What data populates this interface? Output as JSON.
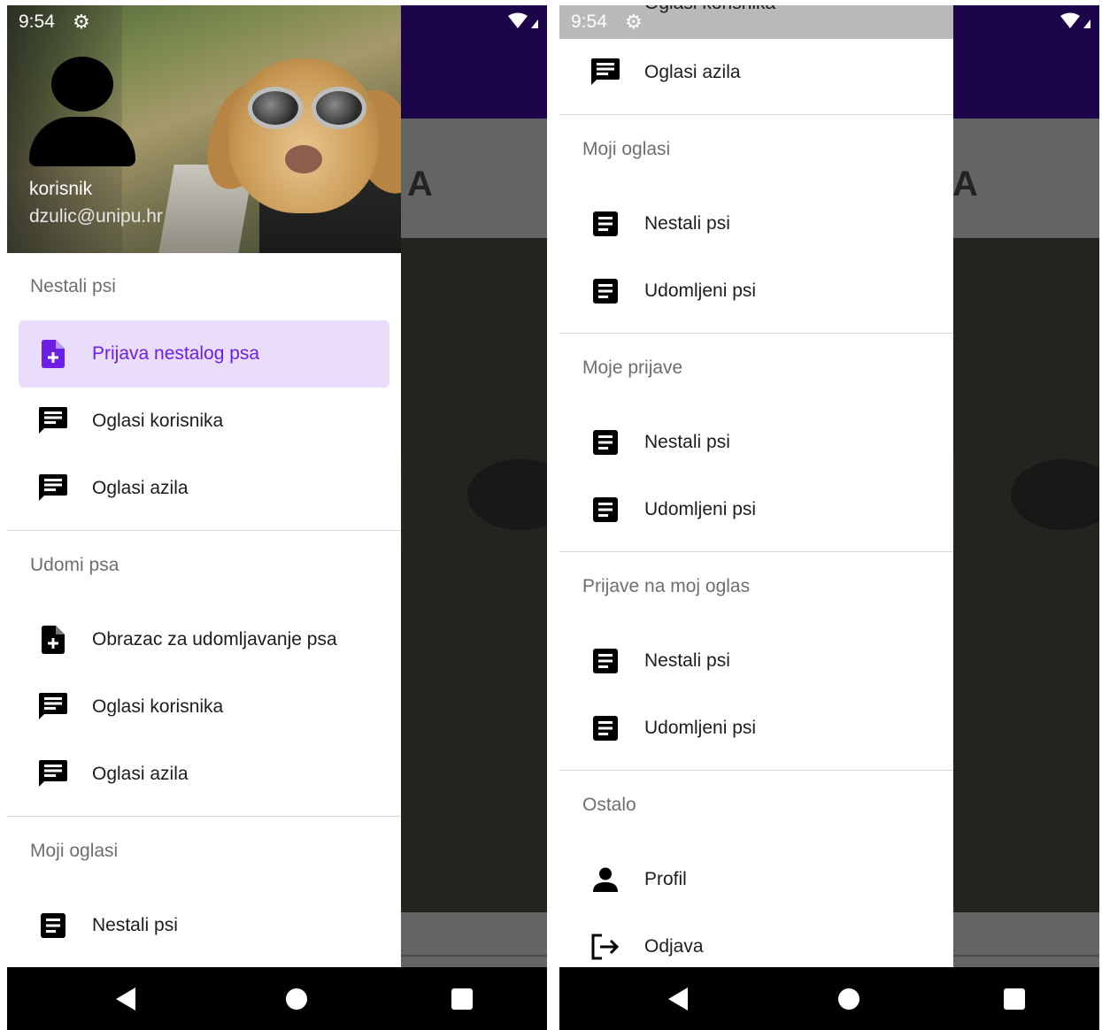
{
  "status_bar": {
    "time": "9:54"
  },
  "background_app": {
    "banner_text_fragment": "A"
  },
  "left_screen": {
    "header": {
      "name": "korisnik",
      "email": "dzulic@unipu.hr"
    },
    "sections": [
      {
        "title": "Nestali psi",
        "items": [
          {
            "label": "Prijava nestalog psa",
            "icon": "add-document-icon",
            "active": true
          },
          {
            "label": "Oglasi korisnika",
            "icon": "chat-message-icon"
          },
          {
            "label": "Oglasi azila",
            "icon": "chat-message-icon"
          }
        ]
      },
      {
        "title": "Udomi psa",
        "items": [
          {
            "label": "Obrazac za udomljavanje psa",
            "icon": "add-document-icon"
          },
          {
            "label": "Oglasi korisnika",
            "icon": "chat-message-icon"
          },
          {
            "label": "Oglasi azila",
            "icon": "chat-message-icon"
          }
        ]
      },
      {
        "title": "Moji oglasi",
        "items": [
          {
            "label": "Nestali psi",
            "icon": "article-icon"
          }
        ]
      }
    ]
  },
  "right_screen": {
    "top_partial_item": {
      "label": "Oglasi korisnika",
      "icon": "chat-message-icon"
    },
    "sections": [
      {
        "title": "",
        "items": [
          {
            "label": "Oglasi azila",
            "icon": "chat-message-icon"
          }
        ]
      },
      {
        "title": "Moji oglasi",
        "items": [
          {
            "label": "Nestali psi",
            "icon": "article-icon"
          },
          {
            "label": "Udomljeni psi",
            "icon": "article-icon"
          }
        ]
      },
      {
        "title": "Moje prijave",
        "items": [
          {
            "label": "Nestali psi",
            "icon": "article-icon"
          },
          {
            "label": "Udomljeni psi",
            "icon": "article-icon"
          }
        ]
      },
      {
        "title": "Prijave na moj oglas",
        "items": [
          {
            "label": "Nestali psi",
            "icon": "article-icon"
          },
          {
            "label": "Udomljeni psi",
            "icon": "article-icon"
          }
        ]
      },
      {
        "title": "Ostalo",
        "items": [
          {
            "label": "Profil",
            "icon": "person-icon"
          },
          {
            "label": "Odjava",
            "icon": "logout-icon"
          }
        ]
      }
    ]
  },
  "colors": {
    "accent": "#6d1fe3",
    "active_bg": "#e9ddfb",
    "app_bar": "#23065a",
    "section_text": "#6e6e6e"
  }
}
